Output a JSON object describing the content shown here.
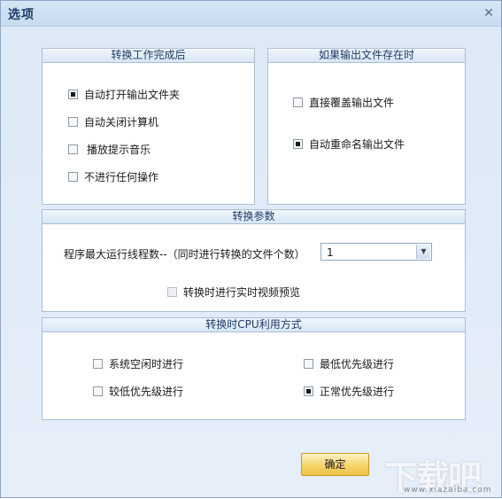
{
  "window": {
    "title": "选项"
  },
  "group_finish": {
    "title": "转换工作完成后",
    "options": [
      {
        "label": "自动打开输出文件夹",
        "checked": true
      },
      {
        "label": "自动关闭计算机",
        "checked": false
      },
      {
        "label": "播放提示音乐",
        "checked": false
      },
      {
        "label": "不进行任何操作",
        "checked": false
      }
    ]
  },
  "group_exists": {
    "title": "如果输出文件存在时",
    "options": [
      {
        "label": "直接覆盖输出文件",
        "checked": false
      },
      {
        "label": "自动重命名输出文件",
        "checked": true
      }
    ]
  },
  "group_params": {
    "title": "转换参数",
    "threads_label": "程序最大运行线程数--（同时进行转换的文件个数）",
    "threads_value": "1",
    "preview": {
      "label": "转换时进行实时视频预览",
      "checked": false,
      "disabled": true
    }
  },
  "group_cpu": {
    "title": "转换时CPU利用方式",
    "options": [
      {
        "label": "系统空闲时进行",
        "checked": false
      },
      {
        "label": "最低优先级进行",
        "checked": false
      },
      {
        "label": "较低优先级进行",
        "checked": false
      },
      {
        "label": "正常优先级进行",
        "checked": true
      }
    ]
  },
  "buttons": {
    "ok": "确定"
  },
  "watermark": {
    "text": "下载吧",
    "url": "www.xiazaiba.com"
  },
  "icons": {
    "close": "close-icon",
    "dropdown": "chevron-down-icon"
  }
}
